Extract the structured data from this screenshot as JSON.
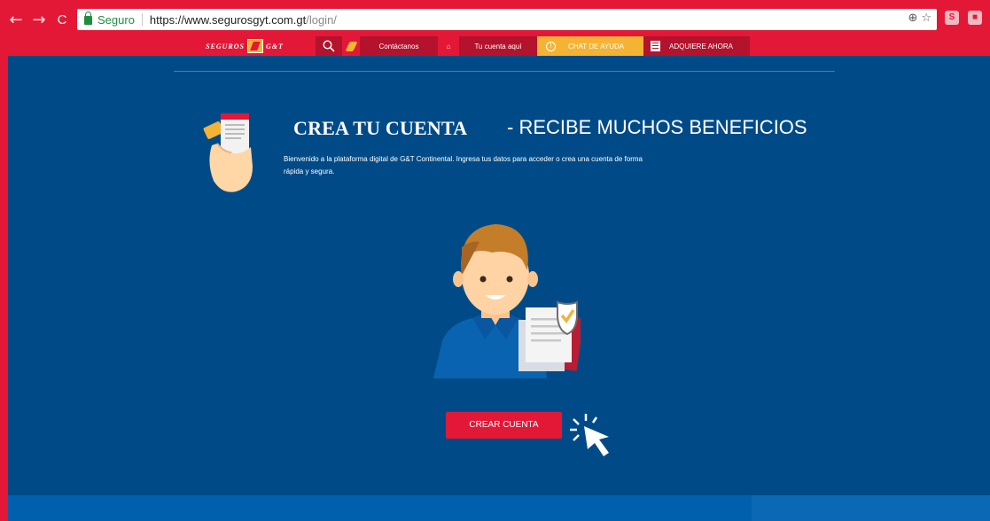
{
  "browser": {
    "back_glyph": "←",
    "forward_glyph": "→",
    "reload_glyph": "C",
    "secure_label": "Seguro",
    "url_host": "https://www.segurosgyt.com.gt",
    "url_path": "/login/",
    "zoom_glyph": "⊕",
    "star_glyph": "☆",
    "ext1": "S",
    "ext2": "■"
  },
  "sitenav": {
    "logo_left": "SEGUROS",
    "logo_right": "G&T",
    "contact": "Contáctanos",
    "home_glyph": "⌂",
    "account": "Tu cuenta aquí",
    "chat_glyph": "!",
    "chat": "CHAT DE AYUDA",
    "buy": "ADQUIERE AHORA"
  },
  "content": {
    "title_strong": "CREA TU CUENTA",
    "title_light": "- RECIBE MUCHOS BENEFICIOS",
    "description": "Bienvenido a la plataforma digital de G&T Continental. Ingresa tus datos para acceder o crea una cuenta de forma rápida y segura.",
    "cta": "CREAR CUENTA"
  },
  "colors": {
    "brand_red": "#e31837",
    "dark_red": "#b3132c",
    "accent_yellow": "#f5b335",
    "panel_blue": "#004b87",
    "band_blue": "#0060ad"
  },
  "icons": [
    "back-icon",
    "forward-icon",
    "reload-icon",
    "lock-icon",
    "zoom-icon",
    "star-icon",
    "search-icon",
    "flame-icon",
    "home-icon",
    "alert-icon",
    "calculator-icon",
    "cursor-icon"
  ]
}
